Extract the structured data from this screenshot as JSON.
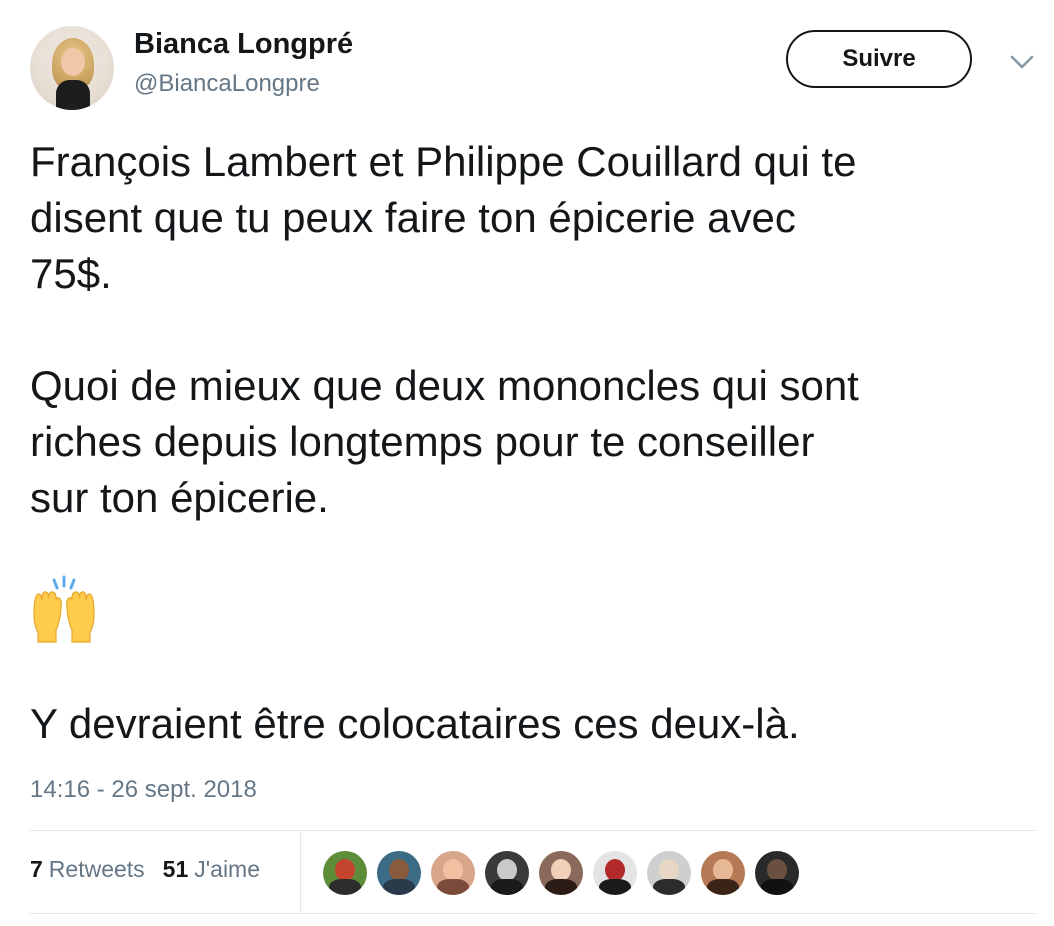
{
  "author": {
    "name": "Bianca Longpré",
    "handle": "@BiancaLongpre"
  },
  "follow_button": {
    "label": "Suivre"
  },
  "caret_icon": "chevron-down-icon",
  "tweet": {
    "lines": [
      "François Lambert et Philippe Couillard qui te",
      "disent que tu peux faire ton épicerie avec",
      "75$.",
      "Quoi de mieux que deux mononcles qui sont",
      "riches depuis longtemps pour te conseiller",
      "sur ton épicerie.",
      "Y devraient être colocataires ces deux-là."
    ],
    "emoji": "raising-hands-emoji"
  },
  "timestamp": "14:16 - 26 sept. 2018",
  "stats": {
    "retweets_count": "7",
    "retweets_label": "Retweets",
    "likes_count": "51",
    "likes_label": "J'aime"
  },
  "likers": [
    {
      "bg": "#5e8d3a",
      "face": "#c4442e",
      "body": "#2c2c2c"
    },
    {
      "bg": "#3c6b86",
      "face": "#8a5a3c",
      "body": "#2a3a4a"
    },
    {
      "bg": "#d6a58a",
      "face": "#f1c0a0",
      "body": "#7a4a3a"
    },
    {
      "bg": "#3a3a3a",
      "face": "#c9c9c9",
      "body": "#1a1a1a"
    },
    {
      "bg": "#8a6a5a",
      "face": "#f0d0b8",
      "body": "#2b1d15"
    },
    {
      "bg": "#e4e4e4",
      "face": "#b22a2a",
      "body": "#1a1a1a"
    },
    {
      "bg": "#cfcfcf",
      "face": "#e8d6c6",
      "body": "#2c2c2c"
    },
    {
      "bg": "#b57a55",
      "face": "#e6b896",
      "body": "#3a2418"
    },
    {
      "bg": "#2a2a2a",
      "face": "#6a5040",
      "body": "#111111"
    }
  ]
}
